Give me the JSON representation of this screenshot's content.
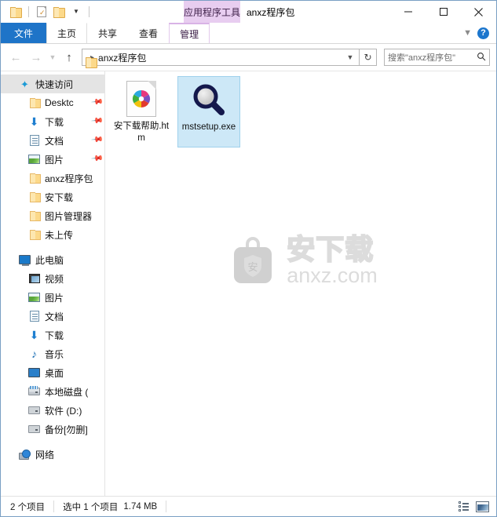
{
  "window": {
    "title": "anxz程序包",
    "contextual_tab_group": "应用程序工具",
    "minimize_label": "最小化",
    "maximize_label": "最大化",
    "close_label": "关闭"
  },
  "quick_access_toolbar": {
    "items": [
      {
        "name": "folder-icon",
        "label": "保存文件夹"
      },
      {
        "name": "properties-icon",
        "label": "属性"
      },
      {
        "name": "new-folder-icon",
        "label": "新建文件夹"
      }
    ],
    "customize_label": "自定义快速访问工具栏"
  },
  "ribbon": {
    "tabs": [
      {
        "id": "file",
        "label": "文件",
        "active": true
      },
      {
        "id": "home",
        "label": "主页",
        "active": false
      },
      {
        "id": "share",
        "label": "共享",
        "active": false
      },
      {
        "id": "view",
        "label": "查看",
        "active": false
      },
      {
        "id": "manage",
        "label": "管理",
        "active": false
      }
    ],
    "collapse_label": "折叠功能区",
    "help_label": "?"
  },
  "addressbar": {
    "back_label": "返回",
    "forward_label": "前进",
    "recent_label": "最近浏览的位置",
    "up_label": "上一级",
    "path_segments": [
      "anxz程序包"
    ],
    "dropdown_label": "以前的位置",
    "refresh_label": "刷新"
  },
  "search": {
    "placeholder": "搜索\"anxz程序包\"",
    "icon": "search-icon"
  },
  "sidebar": {
    "groups": [
      {
        "id": "quick-access",
        "header": {
          "label": "快速访问",
          "icon": "star-pin-icon",
          "selected": true
        },
        "items": [
          {
            "label": "Desktc",
            "icon": "folder-icon",
            "pinned": true
          },
          {
            "label": "下载",
            "icon": "download-icon",
            "pinned": true
          },
          {
            "label": "文档",
            "icon": "documents-icon",
            "pinned": true
          },
          {
            "label": "图片",
            "icon": "pictures-icon",
            "pinned": true
          },
          {
            "label": "anxz程序包",
            "icon": "folder-icon",
            "pinned": false
          },
          {
            "label": "安下载",
            "icon": "folder-icon",
            "pinned": false
          },
          {
            "label": "图片管理器",
            "icon": "folder-icon",
            "pinned": false
          },
          {
            "label": "未上传",
            "icon": "folder-icon",
            "pinned": false
          }
        ]
      },
      {
        "id": "this-pc",
        "header": {
          "label": "此电脑",
          "icon": "computer-icon",
          "selected": false
        },
        "items": [
          {
            "label": "视频",
            "icon": "videos-icon",
            "pinned": false
          },
          {
            "label": "图片",
            "icon": "pictures-icon",
            "pinned": false
          },
          {
            "label": "文档",
            "icon": "documents-icon",
            "pinned": false
          },
          {
            "label": "下载",
            "icon": "download-icon",
            "pinned": false
          },
          {
            "label": "音乐",
            "icon": "music-icon",
            "pinned": false
          },
          {
            "label": "桌面",
            "icon": "desktop-icon",
            "pinned": false
          },
          {
            "label": "本地磁盘 (",
            "icon": "system-drive-icon",
            "pinned": false
          },
          {
            "label": "软件 (D:)",
            "icon": "drive-icon",
            "pinned": false
          },
          {
            "label": "备份[勿删]",
            "icon": "drive-icon",
            "pinned": false
          }
        ]
      },
      {
        "id": "network",
        "header": {
          "label": "网络",
          "icon": "network-icon",
          "selected": false
        },
        "items": []
      }
    ]
  },
  "files": [
    {
      "name": "安下载帮助.htm",
      "icon": "html-document-icon",
      "selected": false
    },
    {
      "name": "mstsetup.exe",
      "icon": "magnifier-application-icon",
      "selected": true
    }
  ],
  "watermark": {
    "chinese": "安下载",
    "english": "anxz.com",
    "badge_char": "安"
  },
  "statusbar": {
    "item_count": "2 个项目",
    "selection": "选中 1 个项目",
    "selection_size": "1.74 MB",
    "views": [
      {
        "id": "details",
        "label": "详细信息",
        "active": false
      },
      {
        "id": "large-icons",
        "label": "大图标",
        "active": true
      }
    ]
  },
  "colors": {
    "file_tab_blue": "#1e74c8",
    "contextual_purple": "#e8cdf0",
    "selection_blue": "#cde8f7",
    "selection_border": "#9fd1ec",
    "folder_yellow": "#fcd98a",
    "watermark_gray": "#dcdcdc"
  }
}
